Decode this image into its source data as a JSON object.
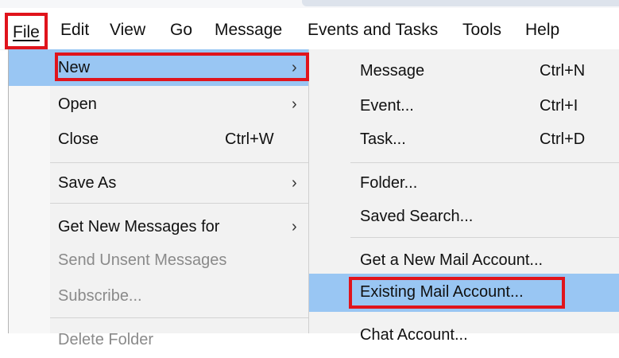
{
  "menubar": {
    "items": [
      {
        "label": "File",
        "u": "F"
      },
      {
        "label": "Edit",
        "u": "E"
      },
      {
        "label": "View",
        "u": "V"
      },
      {
        "label": "Go",
        "u": "G"
      },
      {
        "label": "Message",
        "u": "M"
      },
      {
        "label": "Events and Tasks",
        "u": "n"
      },
      {
        "label": "Tools",
        "u": "T"
      },
      {
        "label": "Help",
        "u": "H"
      }
    ]
  },
  "file_menu": {
    "items": [
      {
        "label": "New",
        "has_submenu": true,
        "highlighted": true
      },
      {
        "label": "Open",
        "has_submenu": true
      },
      {
        "label": "Close",
        "shortcut": "Ctrl+W"
      },
      {
        "label": "Save As",
        "has_submenu": true
      },
      {
        "label": "Get New Messages for",
        "has_submenu": true
      },
      {
        "label": "Send Unsent Messages",
        "disabled": true
      },
      {
        "label": "Subscribe...",
        "disabled": true
      },
      {
        "label": "Delete Folder"
      }
    ]
  },
  "new_submenu": {
    "items": [
      {
        "label": "Message",
        "shortcut": "Ctrl+N"
      },
      {
        "label": "Event...",
        "shortcut": "Ctrl+I"
      },
      {
        "label": "Task...",
        "shortcut": "Ctrl+D"
      },
      {
        "label": "Folder..."
      },
      {
        "label": "Saved Search..."
      },
      {
        "label": "Get a New Mail Account..."
      },
      {
        "label": "Existing Mail Account...",
        "highlighted": true
      },
      {
        "label": "Chat Account..."
      }
    ]
  },
  "colors": {
    "highlight": "#99c6f3",
    "annotation_red": "#e0141c",
    "menu_bg": "#f2f2f2"
  }
}
